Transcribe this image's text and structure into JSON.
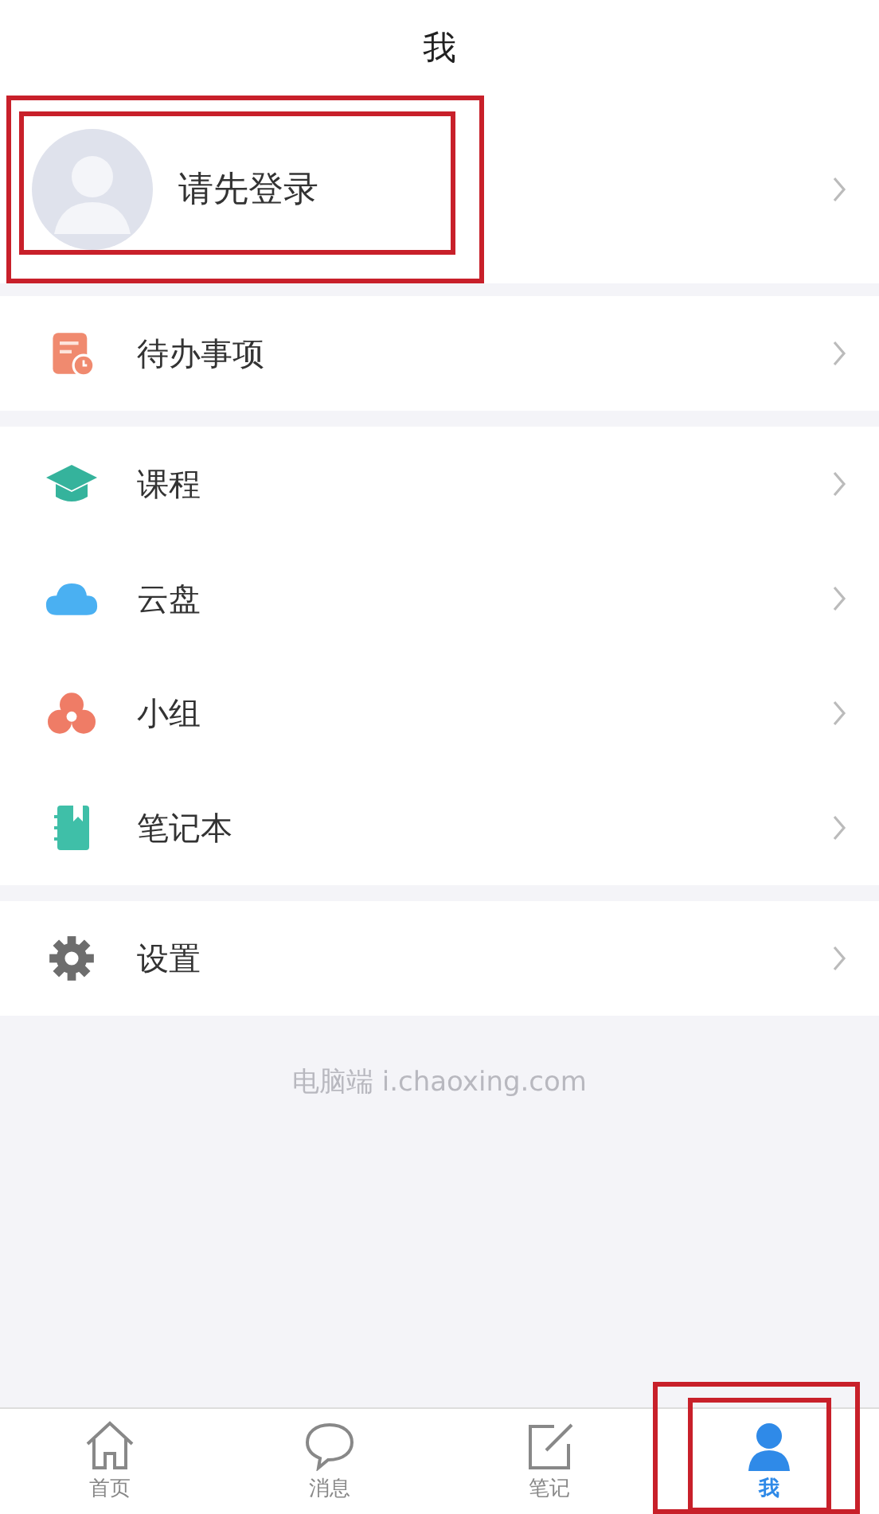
{
  "header": {
    "title": "我"
  },
  "profile": {
    "label": "请先登录"
  },
  "sections": [
    {
      "items": [
        {
          "label": "待办事项"
        }
      ]
    },
    {
      "items": [
        {
          "label": "课程"
        },
        {
          "label": "云盘"
        },
        {
          "label": "小组"
        },
        {
          "label": "笔记本"
        }
      ]
    },
    {
      "items": [
        {
          "label": "设置"
        }
      ]
    }
  ],
  "footer": "电脑端 i.chaoxing.com",
  "tabs": [
    {
      "label": "首页",
      "selected": false
    },
    {
      "label": "消息",
      "selected": false
    },
    {
      "label": "笔记",
      "selected": false
    },
    {
      "label": "我",
      "selected": true
    }
  ]
}
